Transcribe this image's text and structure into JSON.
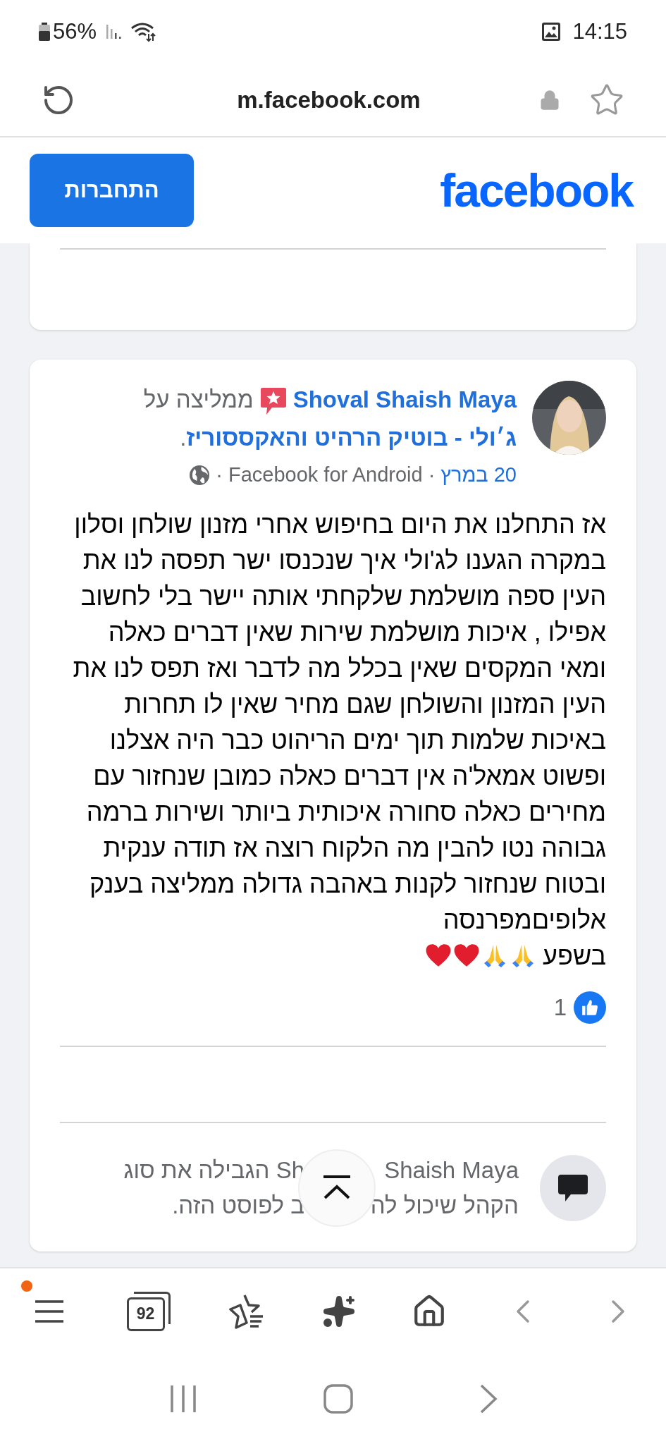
{
  "status_bar": {
    "battery": "56%",
    "time": "14:15"
  },
  "browser": {
    "url": "m.facebook.com",
    "tab_count": "92",
    "menu_badge": true
  },
  "header": {
    "logo": "facebook",
    "login_button": "התחברות"
  },
  "post": {
    "author": "Shoval Shaish Maya",
    "action": "ממליצה על",
    "page": "ג׳ולי - בוטיק הרהיט והאקססוריז",
    "page_suffix": ".",
    "date": "20 במרץ",
    "separators": [
      "·",
      "·"
    ],
    "source": "Facebook for Android",
    "text": "אז התחלנו את היום בחיפוש אחרי מזנון שולחן וסלון במקרה הגענו לג'ולי איך שנכנסו ישר תפסה לנו את העין ספה מושלמת שלקחתי אותה יישר בלי לחשוב אפילו , איכות מושלמת שירות שאין דברים כאלה ומאי המקסים שאין בכלל מה לדבר ואז תפס לנו את העין המזנון והשולחן שגם מחיר שאין לו תחרות באיכות שלמות תוך ימים הריהוט כבר היה אצלנו ופשוט אמאל'ה אין דברים כאלה כמובן שנחזור עם מחירים כאלה סחורה איכותית ביותר ושירות ברמה גבוהה נטו להבין מה הלקוח רוצה אז תודה ענקית ובטוח שנחזור לקנות באהבה גדולה ממליצה בענק אלופיםמפרנסה",
    "text_end": "בשפע",
    "emojis": [
      {
        "kind": "pray"
      },
      {
        "kind": "pray"
      },
      {
        "kind": "heart"
      },
      {
        "kind": "heart"
      }
    ],
    "like_count": "1",
    "restriction_lines": [
      [
        "Shaish Maya",
        "Sh הגבילה את סוג"
      ],
      [
        "הקהל שיכול לה",
        "ב לפוסט הזה."
      ]
    ]
  }
}
